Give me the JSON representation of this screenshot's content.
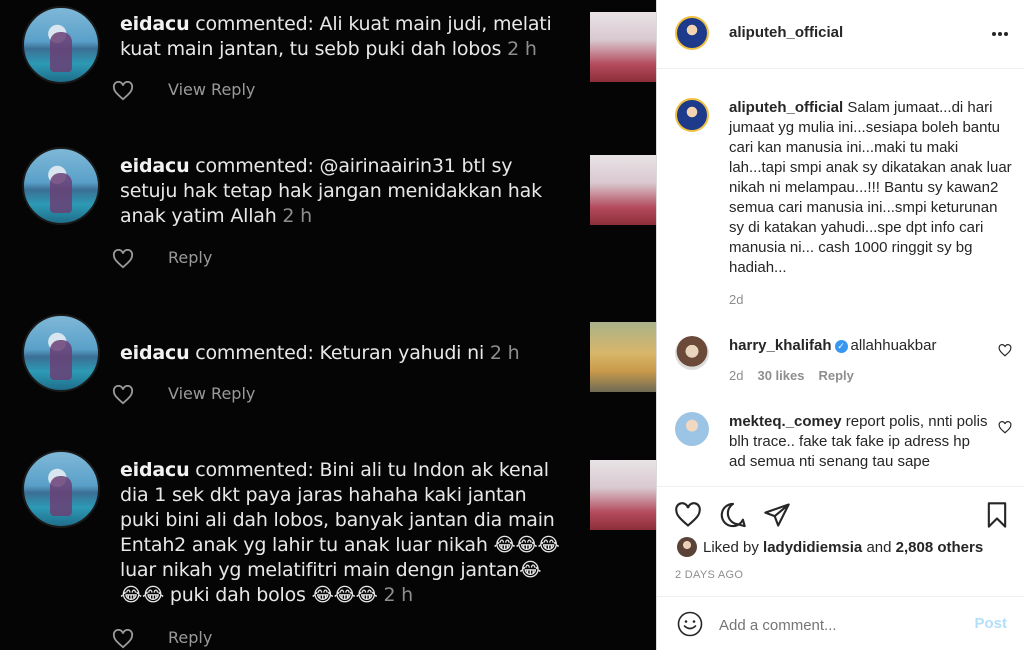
{
  "left_comments": [
    {
      "user": "eidacu",
      "text": "commented: Ali kuat main judi, melati kuat main jantan, tu sebb puki dah lobos",
      "time": "2 h",
      "action": "View Reply"
    },
    {
      "user": "eidacu",
      "text": "commented: @airinaairin31 btl sy setuju hak tetap hak jangan menidakkan hak anak yatim Allah",
      "time": "2 h",
      "action": "Reply"
    },
    {
      "user": "eidacu",
      "text": "commented: Keturan yahudi ni",
      "time": "2 h",
      "action": "View Reply"
    },
    {
      "user": "eidacu",
      "text": "commented: Bini ali tu Indon ak kenal dia 1 sek dkt paya jaras hahaha kaki jantan puki bini ali dah lobos, banyak jantan dia main Entah2 anak yg lahir tu anak luar nikah 😂😂😂 luar nikah yg melatifitri main dengn jantan😂😂😂 puki dah bolos 😂😂😂",
      "time": "2 h",
      "action": "Reply"
    }
  ],
  "header": {
    "username": "aliputeh_official",
    "more_icon": "more-horizontal-icon"
  },
  "caption": {
    "username": "aliputeh_official",
    "text": "Salam jumaat...di hari jumaat yg mulia ini...sesiapa boleh bantu cari kan manusia ini...maki tu maki lah...tapi smpi anak sy dikatakan anak luar nikah ni melampau...!!! Bantu sy kawan2 semua cari manusia ini...smpi keturunan sy di katakan yahudi...spe dpt info cari manusia ni... cash 1000 ringgit sy bg hadiah...",
    "time": "2d"
  },
  "comments": [
    {
      "username": "harry_khalifah",
      "text": "allahhuakbar",
      "time": "2d",
      "likes": "30 likes",
      "reply": "Reply"
    },
    {
      "username": "mekteq._comey",
      "text": "report polis, nnti polis blh trace.. fake tak fake ip adress hp ad semua nti senang tau sape"
    }
  ],
  "likes": {
    "prefix": "Liked by",
    "user": "ladydidiemsia",
    "and": "and",
    "others": "2,808 others"
  },
  "date": "2 DAYS AGO",
  "add_comment": {
    "placeholder": "Add a comment...",
    "post": "Post"
  },
  "colors": {
    "post_disabled": "#b2dffc",
    "verified": "#3897f0"
  }
}
